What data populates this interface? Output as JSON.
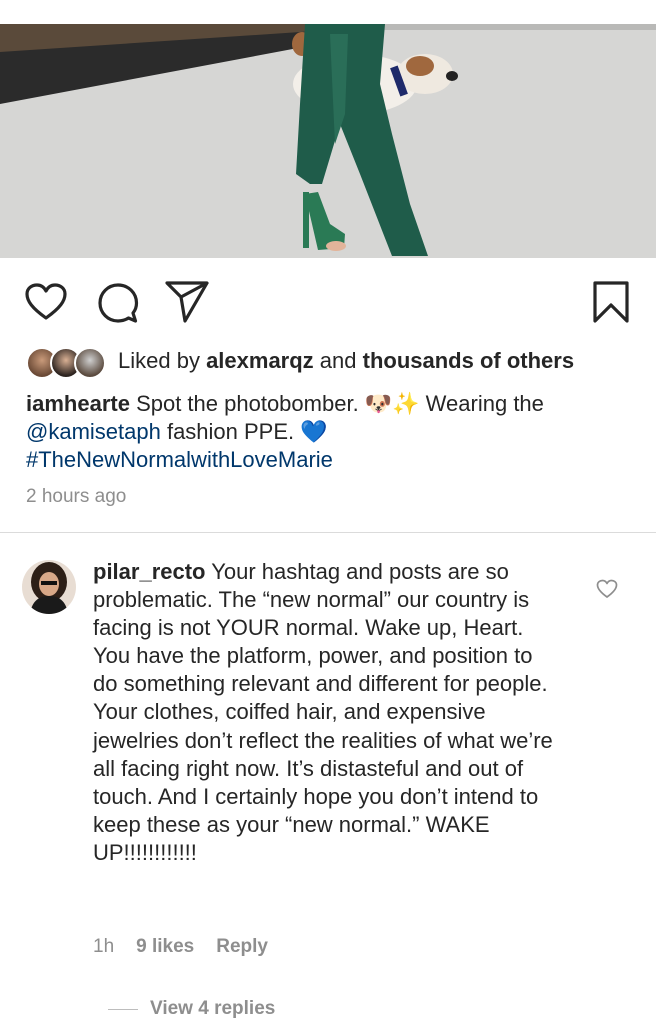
{
  "post": {
    "liked_by_prefix": "Liked by ",
    "liked_by_user": "alexmarqz",
    "liked_by_and": " and ",
    "liked_by_suffix": "thousands of others",
    "caption_user": "iamhearte",
    "caption_part1": " Spot the photobomber. 🐶✨ Wearing the ",
    "caption_mention": "@kamisetaph",
    "caption_part2": " fashion PPE. 💙",
    "caption_hashtag": "#TheNewNormalwithLoveMarie",
    "timestamp": "2 hours ago"
  },
  "comment": {
    "user": "pilar_recto",
    "text": " Your hashtag and posts are so problematic. The “new normal” our country is facing is not YOUR normal. Wake up, Heart. You have the platform, power, and position to do something relevant and different for people. Your clothes, coiffed hair, and expensive jewelries don’t reflect the realities of what we’re all facing right now. It’s distasteful and out of touch. And I certainly hope you don’t intend to keep these as your “new normal.” WAKE UP!!!!!!!!!!!!",
    "age": "1h",
    "likes": "9 likes",
    "reply_label": "Reply",
    "view_replies": "View 4 replies"
  },
  "icons": [
    "heart-icon",
    "comment-icon",
    "share-icon",
    "bookmark-icon",
    "comment-like-icon"
  ],
  "colors": {
    "link": "#00376b",
    "meta": "#8e8e8e",
    "text": "#262626",
    "divider": "#dbdbdb"
  }
}
